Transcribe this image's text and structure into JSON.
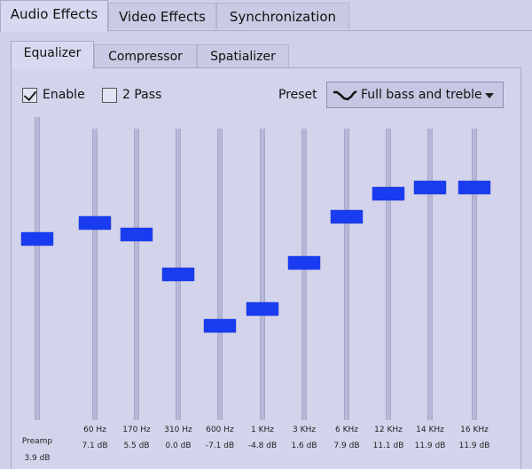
{
  "tabs": [
    "Audio Effects",
    "Video Effects",
    "Synchronization"
  ],
  "active_tab": "Audio Effects",
  "subtabs": [
    "Equalizer",
    "Compressor",
    "Spatializer"
  ],
  "active_subtab": "Equalizer",
  "options": {
    "enable_label": "Enable",
    "enable_checked": true,
    "twopass_label": "2 Pass",
    "twopass_checked": false
  },
  "preset": {
    "label": "Preset",
    "selected": "Full bass and treble",
    "icon": "equalizer-curve-icon"
  },
  "eq": {
    "range_db": [
      -20,
      20
    ],
    "preamp": {
      "label": "Preamp",
      "value": "3.9 dB",
      "db": 3.9
    },
    "bands": [
      {
        "freq": "60 Hz",
        "value": "7.1 dB",
        "db": 7.1
      },
      {
        "freq": "170 Hz",
        "value": "5.5 dB",
        "db": 5.5
      },
      {
        "freq": "310 Hz",
        "value": "0.0 dB",
        "db": 0.0
      },
      {
        "freq": "600 Hz",
        "value": "-7.1 dB",
        "db": -7.1
      },
      {
        "freq": "1 KHz",
        "value": "-4.8 dB",
        "db": -4.8
      },
      {
        "freq": "3 KHz",
        "value": "1.6 dB",
        "db": 1.6
      },
      {
        "freq": "6 KHz",
        "value": "7.9 dB",
        "db": 7.9
      },
      {
        "freq": "12 KHz",
        "value": "11.1 dB",
        "db": 11.1
      },
      {
        "freq": "14 KHz",
        "value": "11.9 dB",
        "db": 11.9
      },
      {
        "freq": "16 KHz",
        "value": "11.9 dB",
        "db": 11.9
      }
    ]
  },
  "colors": {
    "handle": "#1a3cf0",
    "background": "#cfd0ea"
  }
}
